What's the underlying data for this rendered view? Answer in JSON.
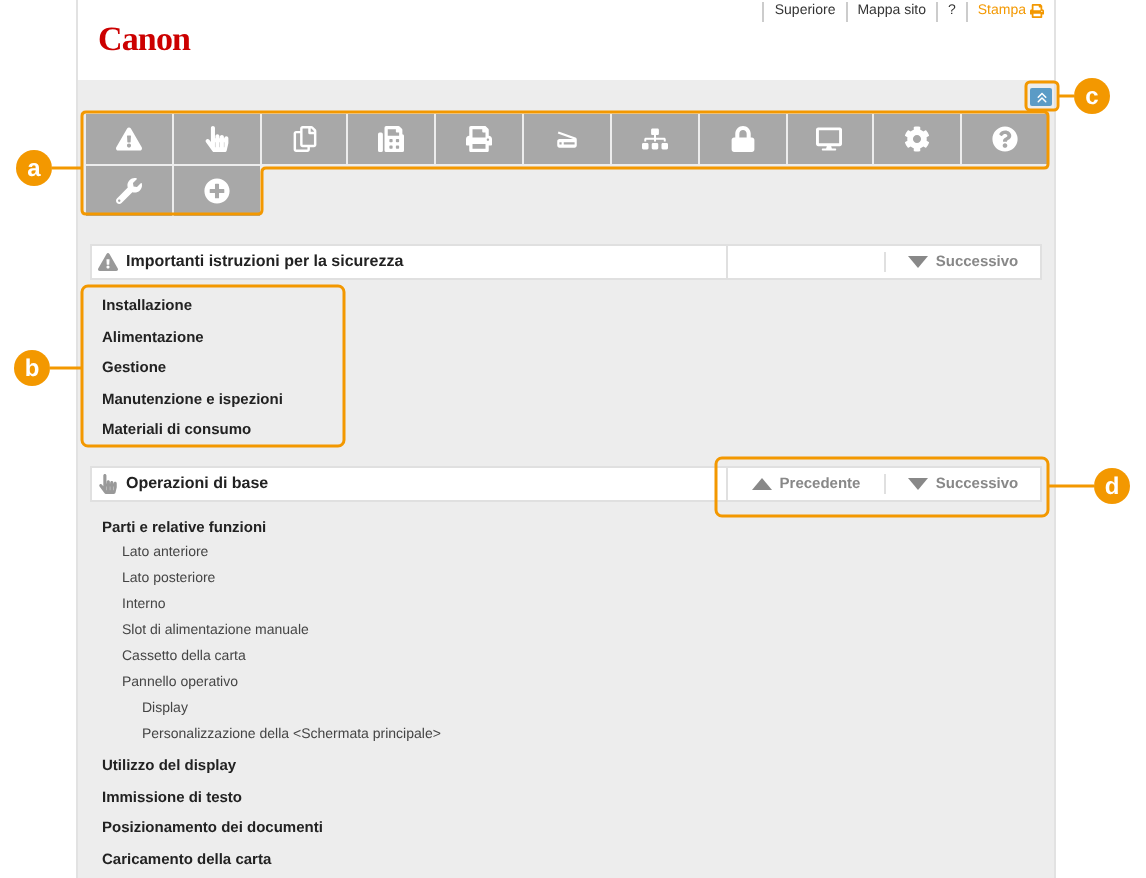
{
  "header": {
    "logo": "Canon",
    "links": [
      {
        "label": "Superiore",
        "kind": "plain"
      },
      {
        "label": "Mappa sito",
        "kind": "plain"
      },
      {
        "label": "?",
        "kind": "plain"
      },
      {
        "label": "Stampa",
        "kind": "print"
      }
    ]
  },
  "sections": [
    {
      "title": "Importanti istruzioni per la sicurezza",
      "kind": "warning",
      "nav": [
        {
          "label": "Successivo",
          "kind": "next"
        }
      ],
      "items": [
        {
          "label": "Installazione"
        },
        {
          "label": "Alimentazione"
        },
        {
          "label": "Gestione"
        },
        {
          "label": "Manutenzione e ispezioni"
        },
        {
          "label": "Materiali di consumo"
        }
      ]
    },
    {
      "title": "Operazioni di base",
      "kind": "hand",
      "nav": [
        {
          "label": "Precedente",
          "kind": "previous"
        },
        {
          "label": "Successivo",
          "kind": "next"
        }
      ],
      "items": [
        {
          "label": "Parti e relative funzioni",
          "children": [
            {
              "label": "Lato anteriore"
            },
            {
              "label": "Lato posteriore"
            },
            {
              "label": "Interno"
            },
            {
              "label": "Slot di alimentazione manuale"
            },
            {
              "label": "Cassetto della carta"
            },
            {
              "label": "Pannello operativo",
              "children": [
                {
                  "label": "Display"
                },
                {
                  "label": "Personalizzazione della <Schermata principale>"
                }
              ]
            }
          ]
        },
        {
          "label": "Utilizzo del display"
        },
        {
          "label": "Immissione di testo"
        },
        {
          "label": "Posizionamento dei documenti"
        },
        {
          "label": "Caricamento della carta"
        }
      ]
    }
  ],
  "callouts": [
    {
      "label": "a"
    },
    {
      "label": "b"
    },
    {
      "label": "c"
    },
    {
      "label": "d"
    }
  ]
}
